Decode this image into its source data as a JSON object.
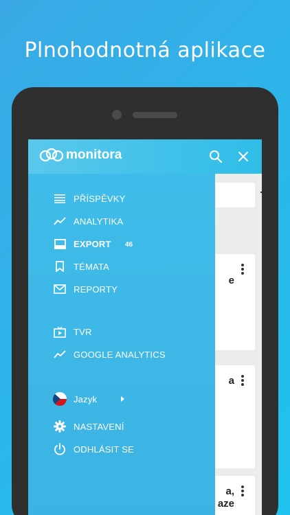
{
  "headline": "Plnohodnotná aplikace",
  "app": {
    "brand": "monitora",
    "search_icon": "search-icon",
    "close_icon": "close-icon"
  },
  "drawer": {
    "items": [
      {
        "label": "PŘÍSPĚVKY",
        "icon": "list-icon"
      },
      {
        "label": "ANALYTIKA",
        "icon": "trend-icon"
      },
      {
        "label": "EXPORT",
        "icon": "inbox-icon",
        "badge": "46"
      },
      {
        "label": "TÉMATA",
        "icon": "bookmark-icon"
      },
      {
        "label": "REPORTY",
        "icon": "mail-icon"
      },
      {
        "label": "TVR",
        "icon": "tv-icon"
      },
      {
        "label": "GOOGLE ANALYTICS",
        "icon": "trend-icon"
      },
      {
        "label": "Jazyk",
        "icon": "czech-flag-icon"
      },
      {
        "label": "NASTAVENÍ",
        "icon": "gear-icon"
      },
      {
        "label": "ODHLÁSIT SE",
        "icon": "power-icon"
      }
    ]
  },
  "content": {
    "peek_1": "e",
    "peek_2": "a",
    "peek_3_line1": "a,",
    "peek_3_line2": "aze"
  },
  "colors": {
    "background": "#2fb7ea",
    "drawer": "#3cb8e6",
    "phone": "#2f2f2f"
  }
}
